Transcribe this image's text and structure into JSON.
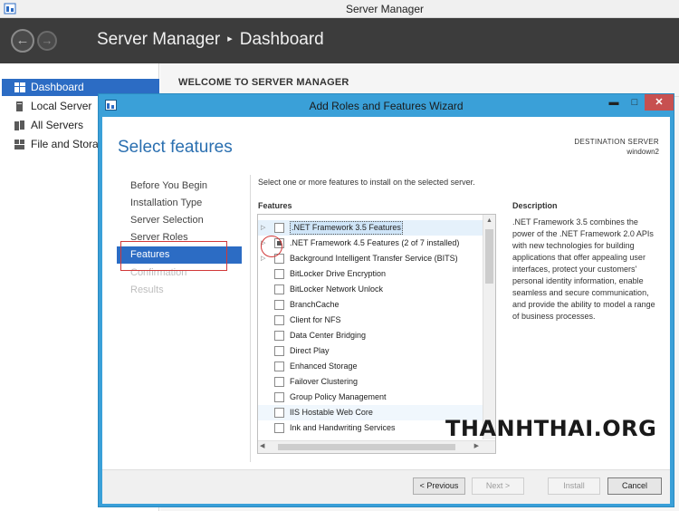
{
  "os_window": {
    "title": "Server Manager"
  },
  "header": {
    "breadcrumb_app": "Server Manager",
    "breadcrumb_separator": "▸",
    "breadcrumb_page": "Dashboard"
  },
  "sidebar": {
    "items": [
      {
        "label": "Dashboard",
        "icon": "dashboard-grid-icon",
        "active": true
      },
      {
        "label": "Local Server",
        "icon": "server-icon"
      },
      {
        "label": "All Servers",
        "icon": "servers-icon"
      },
      {
        "label": "File and Storag",
        "icon": "file-storage-icon"
      }
    ]
  },
  "main": {
    "welcome_heading": "WELCOME TO SERVER MANAGER"
  },
  "wizard": {
    "title": "Add Roles and Features Wizard",
    "heading": "Select features",
    "destination_label": "DESTINATION SERVER",
    "destination_server": "windown2",
    "steps": [
      {
        "label": "Before You Begin"
      },
      {
        "label": "Installation Type"
      },
      {
        "label": "Server Selection"
      },
      {
        "label": "Server Roles"
      },
      {
        "label": "Features",
        "active": true
      },
      {
        "label": "Confirmation",
        "disabled": true
      },
      {
        "label": "Results",
        "disabled": true
      }
    ],
    "instruction": "Select one or more features to install on the selected server.",
    "features_label": "Features",
    "features": [
      {
        "label": ".NET Framework 3.5 Features",
        "expandable": true,
        "checked": false,
        "selected": true
      },
      {
        "label": ".NET Framework 4.5 Features (2 of 7 installed)",
        "expandable": true,
        "partial": true
      },
      {
        "label": "Background Intelligent Transfer Service (BITS)",
        "expandable": true
      },
      {
        "label": "BitLocker Drive Encryption"
      },
      {
        "label": "BitLocker Network Unlock"
      },
      {
        "label": "BranchCache"
      },
      {
        "label": "Client for NFS"
      },
      {
        "label": "Data Center Bridging"
      },
      {
        "label": "Direct Play"
      },
      {
        "label": "Enhanced Storage"
      },
      {
        "label": "Failover Clustering"
      },
      {
        "label": "Group Policy Management"
      },
      {
        "label": "IIS Hostable Web Core",
        "hover": true
      },
      {
        "label": "Ink and Handwriting Services"
      }
    ],
    "description_label": "Description",
    "description": ".NET Framework 3.5 combines the power of the .NET Framework 2.0 APIs with new technologies for building applications that offer appealing user interfaces, protect your customers' personal identity information, enable seamless and secure communication, and provide the ability to model a range of business processes.",
    "buttons": {
      "previous": "< Previous",
      "next": "Next >",
      "install": "Install",
      "cancel": "Cancel"
    },
    "window_controls": {
      "minimize": "▬",
      "maximize": "□",
      "close": "✕"
    }
  },
  "watermark": "THANHTHAI.ORG",
  "colors": {
    "accent": "#2c6cc4",
    "wizard_frame": "#3aa0d8",
    "heading": "#2a6fb0",
    "highlight": "#d23838"
  }
}
